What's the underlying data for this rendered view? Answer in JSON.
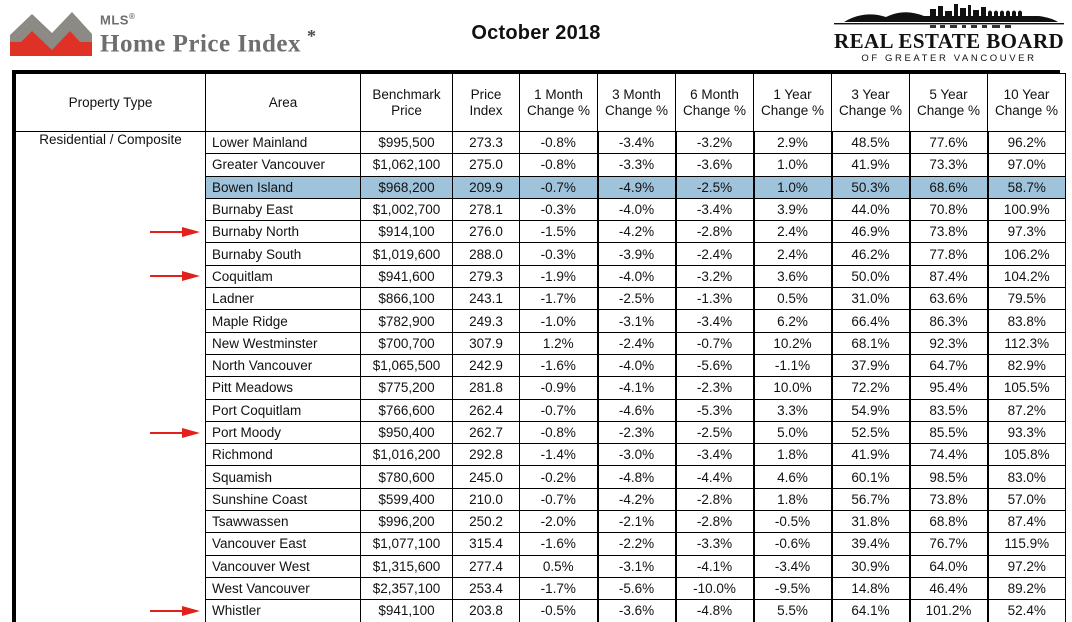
{
  "header": {
    "brand_mls_small": "MLS",
    "brand_mls_big": "Home Price Index",
    "brand_mls_asterisk": "*",
    "title": "October 2018",
    "reb_main": "REAL ESTATE BOARD",
    "reb_sub": "OF GREATER VANCOUVER",
    "logo_red": "#e03127",
    "logo_grey": "#8c8a85"
  },
  "table": {
    "columns": [
      "Property Type",
      "Area",
      "Benchmark Price",
      "Price Index",
      "1 Month Change %",
      "3 Month Change %",
      "6 Month Change %",
      "1 Year Change %",
      "3 Year Change %",
      "5 Year Change %",
      "10 Year Change %"
    ],
    "column_lines": [
      [
        "Property Type",
        ""
      ],
      [
        "Area",
        ""
      ],
      [
        "Benchmark",
        "Price"
      ],
      [
        "Price",
        "Index"
      ],
      [
        "1 Month",
        "Change %"
      ],
      [
        "3 Month",
        "Change %"
      ],
      [
        "6 Month",
        "Change %"
      ],
      [
        "1 Year",
        "Change %"
      ],
      [
        "3 Year",
        "Change %"
      ],
      [
        "5 Year",
        "Change %"
      ],
      [
        "10 Year",
        "Change %"
      ]
    ],
    "property_type": "Residential / Composite",
    "highlight_color": "#a0c3dc",
    "arrow_color": "#e2211c",
    "rows": [
      {
        "area": "Lower Mainland",
        "benchmark": "$995,500",
        "index": "273.3",
        "m1": "-0.8%",
        "m3": "-3.4%",
        "m6": "-3.2%",
        "y1": "2.9%",
        "y3": "48.5%",
        "y5": "77.6%",
        "y10": "96.2%",
        "highlight": false,
        "arrow": false
      },
      {
        "area": "Greater Vancouver",
        "benchmark": "$1,062,100",
        "index": "275.0",
        "m1": "-0.8%",
        "m3": "-3.3%",
        "m6": "-3.6%",
        "y1": "1.0%",
        "y3": "41.9%",
        "y5": "73.3%",
        "y10": "97.0%",
        "highlight": false,
        "arrow": false
      },
      {
        "area": "Bowen Island",
        "benchmark": "$968,200",
        "index": "209.9",
        "m1": "-0.7%",
        "m3": "-4.9%",
        "m6": "-2.5%",
        "y1": "1.0%",
        "y3": "50.3%",
        "y5": "68.6%",
        "y10": "58.7%",
        "highlight": true,
        "arrow": false
      },
      {
        "area": "Burnaby East",
        "benchmark": "$1,002,700",
        "index": "278.1",
        "m1": "-0.3%",
        "m3": "-4.0%",
        "m6": "-3.4%",
        "y1": "3.9%",
        "y3": "44.0%",
        "y5": "70.8%",
        "y10": "100.9%",
        "highlight": false,
        "arrow": false
      },
      {
        "area": "Burnaby North",
        "benchmark": "$914,100",
        "index": "276.0",
        "m1": "-1.5%",
        "m3": "-4.2%",
        "m6": "-2.8%",
        "y1": "2.4%",
        "y3": "46.9%",
        "y5": "73.8%",
        "y10": "97.3%",
        "highlight": false,
        "arrow": true
      },
      {
        "area": "Burnaby South",
        "benchmark": "$1,019,600",
        "index": "288.0",
        "m1": "-0.3%",
        "m3": "-3.9%",
        "m6": "-2.4%",
        "y1": "2.4%",
        "y3": "46.2%",
        "y5": "77.8%",
        "y10": "106.2%",
        "highlight": false,
        "arrow": false
      },
      {
        "area": "Coquitlam",
        "benchmark": "$941,600",
        "index": "279.3",
        "m1": "-1.9%",
        "m3": "-4.0%",
        "m6": "-3.2%",
        "y1": "3.6%",
        "y3": "50.0%",
        "y5": "87.4%",
        "y10": "104.2%",
        "highlight": false,
        "arrow": true
      },
      {
        "area": "Ladner",
        "benchmark": "$866,100",
        "index": "243.1",
        "m1": "-1.7%",
        "m3": "-2.5%",
        "m6": "-1.3%",
        "y1": "0.5%",
        "y3": "31.0%",
        "y5": "63.6%",
        "y10": "79.5%",
        "highlight": false,
        "arrow": false
      },
      {
        "area": "Maple Ridge",
        "benchmark": "$782,900",
        "index": "249.3",
        "m1": "-1.0%",
        "m3": "-3.1%",
        "m6": "-3.4%",
        "y1": "6.2%",
        "y3": "66.4%",
        "y5": "86.3%",
        "y10": "83.8%",
        "highlight": false,
        "arrow": false
      },
      {
        "area": "New Westminster",
        "benchmark": "$700,700",
        "index": "307.9",
        "m1": "1.2%",
        "m3": "-2.4%",
        "m6": "-0.7%",
        "y1": "10.2%",
        "y3": "68.1%",
        "y5": "92.3%",
        "y10": "112.3%",
        "highlight": false,
        "arrow": false
      },
      {
        "area": "North Vancouver",
        "benchmark": "$1,065,500",
        "index": "242.9",
        "m1": "-1.6%",
        "m3": "-4.0%",
        "m6": "-5.6%",
        "y1": "-1.1%",
        "y3": "37.9%",
        "y5": "64.7%",
        "y10": "82.9%",
        "highlight": false,
        "arrow": false
      },
      {
        "area": "Pitt Meadows",
        "benchmark": "$775,200",
        "index": "281.8",
        "m1": "-0.9%",
        "m3": "-4.1%",
        "m6": "-2.3%",
        "y1": "10.0%",
        "y3": "72.2%",
        "y5": "95.4%",
        "y10": "105.5%",
        "highlight": false,
        "arrow": false
      },
      {
        "area": "Port Coquitlam",
        "benchmark": "$766,600",
        "index": "262.4",
        "m1": "-0.7%",
        "m3": "-4.6%",
        "m6": "-5.3%",
        "y1": "3.3%",
        "y3": "54.9%",
        "y5": "83.5%",
        "y10": "87.2%",
        "highlight": false,
        "arrow": false
      },
      {
        "area": "Port Moody",
        "benchmark": "$950,400",
        "index": "262.7",
        "m1": "-0.8%",
        "m3": "-2.3%",
        "m6": "-2.5%",
        "y1": "5.0%",
        "y3": "52.5%",
        "y5": "85.5%",
        "y10": "93.3%",
        "highlight": false,
        "arrow": true
      },
      {
        "area": "Richmond",
        "benchmark": "$1,016,200",
        "index": "292.8",
        "m1": "-1.4%",
        "m3": "-3.0%",
        "m6": "-3.4%",
        "y1": "1.8%",
        "y3": "41.9%",
        "y5": "74.4%",
        "y10": "105.8%",
        "highlight": false,
        "arrow": false
      },
      {
        "area": "Squamish",
        "benchmark": "$780,600",
        "index": "245.0",
        "m1": "-0.2%",
        "m3": "-4.8%",
        "m6": "-4.4%",
        "y1": "4.6%",
        "y3": "60.1%",
        "y5": "98.5%",
        "y10": "83.0%",
        "highlight": false,
        "arrow": false
      },
      {
        "area": "Sunshine Coast",
        "benchmark": "$599,400",
        "index": "210.0",
        "m1": "-0.7%",
        "m3": "-4.2%",
        "m6": "-2.8%",
        "y1": "1.8%",
        "y3": "56.7%",
        "y5": "73.8%",
        "y10": "57.0%",
        "highlight": false,
        "arrow": false
      },
      {
        "area": "Tsawwassen",
        "benchmark": "$996,200",
        "index": "250.2",
        "m1": "-2.0%",
        "m3": "-2.1%",
        "m6": "-2.8%",
        "y1": "-0.5%",
        "y3": "31.8%",
        "y5": "68.8%",
        "y10": "87.4%",
        "highlight": false,
        "arrow": false
      },
      {
        "area": "Vancouver East",
        "benchmark": "$1,077,100",
        "index": "315.4",
        "m1": "-1.6%",
        "m3": "-2.2%",
        "m6": "-3.3%",
        "y1": "-0.6%",
        "y3": "39.4%",
        "y5": "76.7%",
        "y10": "115.9%",
        "highlight": false,
        "arrow": false
      },
      {
        "area": "Vancouver West",
        "benchmark": "$1,315,600",
        "index": "277.4",
        "m1": "0.5%",
        "m3": "-3.1%",
        "m6": "-4.1%",
        "y1": "-3.4%",
        "y3": "30.9%",
        "y5": "64.0%",
        "y10": "97.2%",
        "highlight": false,
        "arrow": false
      },
      {
        "area": "West Vancouver",
        "benchmark": "$2,357,100",
        "index": "253.4",
        "m1": "-1.7%",
        "m3": "-5.6%",
        "m6": "-10.0%",
        "y1": "-9.5%",
        "y3": "14.8%",
        "y5": "46.4%",
        "y10": "89.2%",
        "highlight": false,
        "arrow": false
      },
      {
        "area": "Whistler",
        "benchmark": "$941,100",
        "index": "203.8",
        "m1": "-0.5%",
        "m3": "-3.6%",
        "m6": "-4.8%",
        "y1": "5.5%",
        "y3": "64.1%",
        "y5": "101.2%",
        "y10": "52.4%",
        "highlight": false,
        "arrow": true
      }
    ]
  }
}
